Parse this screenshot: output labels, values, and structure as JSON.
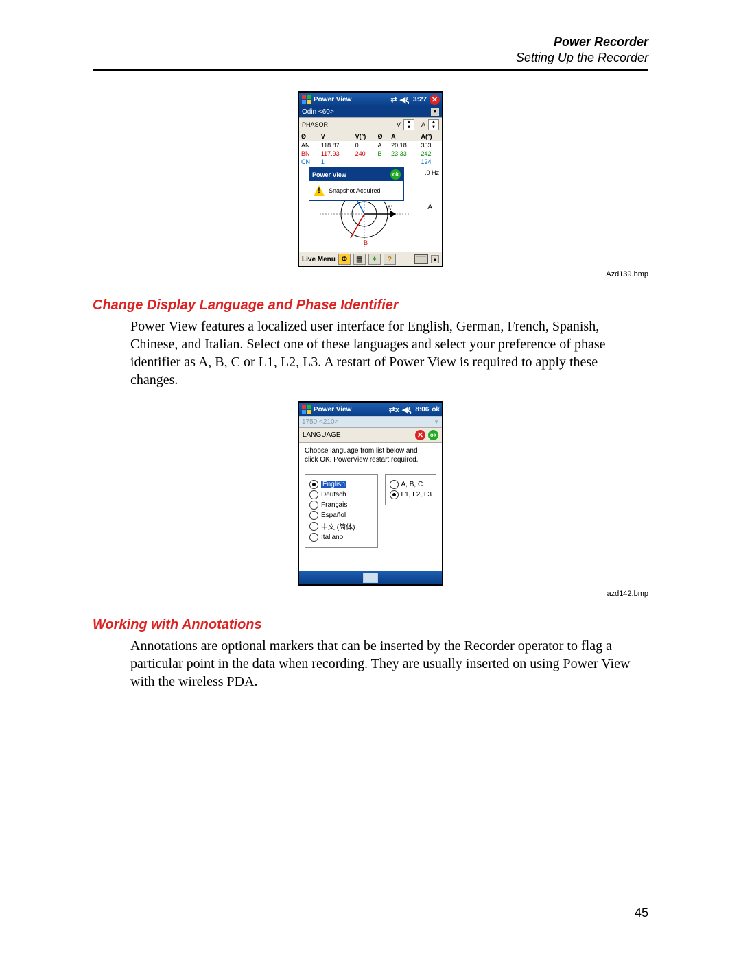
{
  "header": {
    "title": "Power Recorder",
    "subtitle": "Setting Up the Recorder"
  },
  "figure1": {
    "title": "Power View",
    "conn_icon": "⇄",
    "speaker_icon": "◀ξ",
    "time": "3:27",
    "subbar": "Odin <60>",
    "phasor_label": "PHASOR",
    "v_hdr_short": "V",
    "a_hdr_short": "A",
    "cols_left": [
      "Ø",
      "V",
      "V(°)"
    ],
    "cols_right": [
      "Ø",
      "A",
      "A(°)"
    ],
    "rows": [
      {
        "l": [
          "AN",
          "118.87",
          "0"
        ],
        "r": [
          "A",
          "20.18",
          "353"
        ]
      },
      {
        "l": [
          "BN",
          "117.93",
          "240"
        ],
        "r": [
          "B",
          "23.33",
          "242"
        ]
      },
      {
        "l": [
          "CN",
          "1",
          ""
        ],
        "r": [
          "",
          "",
          "124"
        ]
      }
    ],
    "popup_title": "Power View",
    "popup_ok": "ok",
    "popup_text": "Snapshot Acquired",
    "hz": ".0 Hz",
    "ab_label": "A",
    "live_menu": "Live Menu",
    "phi_icon": "Φ",
    "doc_icon": "▤",
    "exp_icon": "✧",
    "help_icon": "?",
    "caption": "Azd139.bmp"
  },
  "section1": {
    "heading": "Change Display Language and Phase Identifier",
    "text": "Power View features a localized user interface for English, German, French, Spanish, Chinese, and Italian. Select one of these languages and select your preference of phase identifier as A, B, C or L1, L2, L3. A restart of Power View is required to apply these changes."
  },
  "figure2": {
    "title": "Power View",
    "conn_icon": "⇄x",
    "speaker_icon": "◀ξ",
    "time": "8:06",
    "ok": "ok",
    "subbar": "1750 <210>",
    "langbar_label": "LANGUAGE",
    "msg1": "Choose language from list below and",
    "msg2": "click OK. PowerView restart required.",
    "languages": [
      "English",
      "Deutsch",
      "Français",
      "Español",
      "中文 (简体)",
      "Italiano"
    ],
    "lang_selected": 0,
    "phase_options": [
      "A, B, C",
      "L1, L2, L3"
    ],
    "phase_selected": 1,
    "caption": "azd142.bmp"
  },
  "section2": {
    "heading": "Working with Annotations",
    "text": "Annotations are optional markers that can be inserted by the Recorder operator to flag a particular point in the data when recording. They are usually inserted on using Power View with the wireless PDA."
  },
  "page_number": "45"
}
